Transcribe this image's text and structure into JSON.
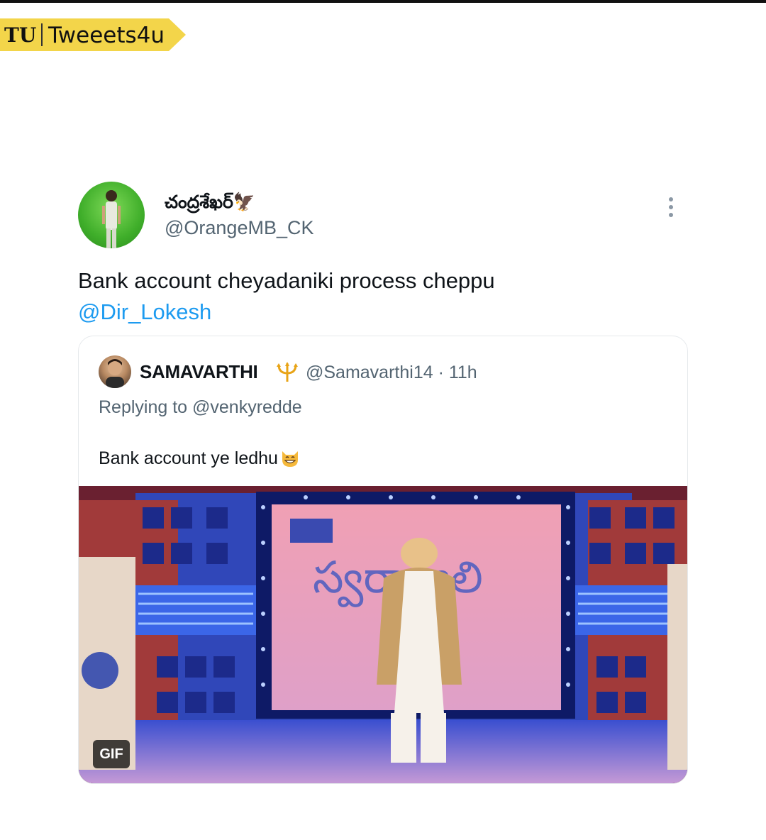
{
  "watermark": {
    "logo": "TU",
    "name": "Tweeets4u"
  },
  "tweet": {
    "display_name": "చంద్రశేఖర్🦅",
    "handle": "@OrangeMB_CK",
    "text": "Bank account cheyadaniki process cheppu",
    "mention": "@Dir_Lokesh",
    "more_icon": "more-vertical-icon"
  },
  "quote": {
    "display_name": "SAMAVARTHI",
    "badge_icon": "trident-icon",
    "handle_time": "@Samavarthi14 · 11h",
    "replying_to": "Replying to @venkyredde",
    "text": "Bank account ye ledhu",
    "emoji_icon": "grinning-cat-icon",
    "media": {
      "badge": "GIF",
      "stage_text": "స్వరా జలి"
    }
  },
  "colors": {
    "accent": "#1d9bf0",
    "secondary_text": "#536471",
    "watermark_yellow": "#f5d547"
  }
}
